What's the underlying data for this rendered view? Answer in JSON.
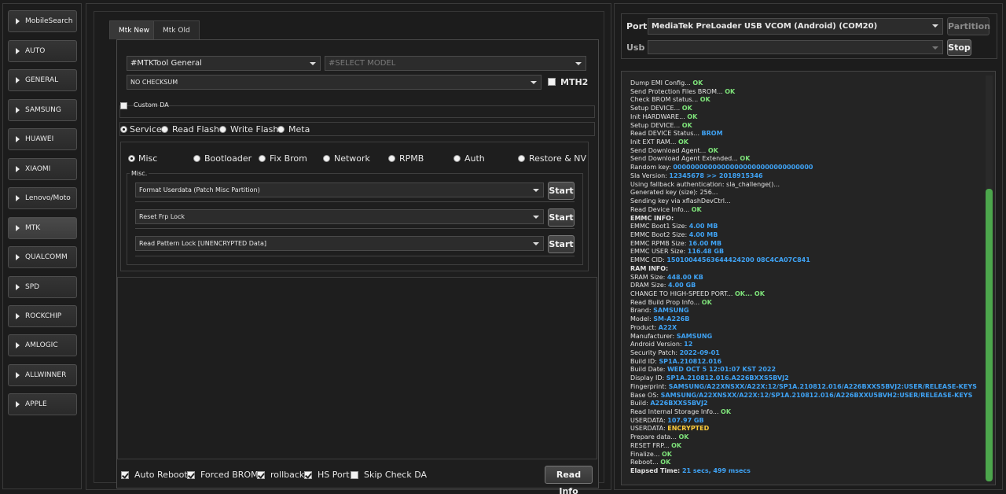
{
  "sidebar": {
    "items": [
      {
        "label": "MobileSearch"
      },
      {
        "label": "AUTO"
      },
      {
        "label": "GENERAL"
      },
      {
        "label": "SAMSUNG"
      },
      {
        "label": "HUAWEI"
      },
      {
        "label": "XIAOMI"
      },
      {
        "label": "Lenovo/Moto"
      },
      {
        "label": "MTK",
        "active": true
      },
      {
        "label": "QUALCOMM"
      },
      {
        "label": "SPD"
      },
      {
        "label": "ROCKCHIP"
      },
      {
        "label": "AMLOGIC"
      },
      {
        "label": "ALLWINNER"
      },
      {
        "label": "APPLE"
      }
    ]
  },
  "tabs": [
    {
      "label": "Mtk New",
      "active": true
    },
    {
      "label": "Mtk Old",
      "active": false
    }
  ],
  "config": {
    "tool_select": "#MTKTool General",
    "model_select": "#SELECT MODEL",
    "checksum_select": "NO CHECKSUM",
    "mth2_label": "MTH2",
    "custom_da_label": "Custom DA"
  },
  "modes": [
    "Service",
    "Read Flash",
    "Write Flash",
    "Meta"
  ],
  "sub_modes": [
    "Misc",
    "Bootloader",
    "Fix Brom",
    "Network",
    "RPMB",
    "Auth",
    "Restore & NV"
  ],
  "misc": {
    "group_label": "Misc.",
    "ops": [
      {
        "label": "Format Userdata (Patch Misc Partition)",
        "button": "Start"
      },
      {
        "label": "Reset Frp Lock",
        "button": "Start"
      },
      {
        "label": "Read Pattern Lock [UNENCRYPTED Data]",
        "button": "Start"
      }
    ]
  },
  "options": {
    "auto_reboot": "Auto Reboot",
    "forced_brom": "Forced BROM",
    "rollback": "rollback",
    "hs_port": "HS Port",
    "skip_check_da": "Skip Check DA",
    "read_info_button": "Read Info"
  },
  "port": {
    "port_label": "Port",
    "port_value": "MediaTek PreLoader USB VCOM (Android) (COM20)",
    "partition_button": "Partition",
    "usb_label": "Usb",
    "usb_value": "",
    "stop_button": "Stop"
  },
  "log": [
    {
      "text": "Dump EMI Config... ",
      "value": "OK",
      "type": "ok"
    },
    {
      "text": "Send Protection Files BROM... ",
      "value": "OK",
      "type": "ok"
    },
    {
      "text": "Check BROM status... ",
      "value": "OK",
      "type": "ok"
    },
    {
      "text": "Setup DEVICE... ",
      "value": "OK",
      "type": "ok"
    },
    {
      "text": "Init HARDWARE... ",
      "value": "OK",
      "type": "ok"
    },
    {
      "text": "Setup DEVICE... ",
      "value": "OK",
      "type": "ok"
    },
    {
      "text": "Read DEVICE Status... ",
      "value": "BROM",
      "type": "info"
    },
    {
      "text": "Init EXT RAM... ",
      "value": "OK",
      "type": "ok"
    },
    {
      "text": "Send Download Agent... ",
      "value": "OK",
      "type": "ok"
    },
    {
      "text": "Send Download Agent Extended... ",
      "value": "OK",
      "type": "ok"
    },
    {
      "text": "Random key:  ",
      "value": "00000000000000000000000000000000",
      "type": "info"
    },
    {
      "text": "Sla Version:  ",
      "value": "12345678  >> 2018915346",
      "type": "info"
    },
    {
      "text": "Using fallback authentication: sla_challenge()...",
      "value": "",
      "type": ""
    },
    {
      "text": "Generated key (size): 256...",
      "value": "",
      "type": ""
    },
    {
      "text": "Sending key via xflashDevCtrl...",
      "value": "",
      "type": ""
    },
    {
      "text": "Read Device Info... ",
      "value": "OK",
      "type": "ok"
    },
    {
      "text": "EMMC INFO:",
      "value": "",
      "type": "",
      "bold": true
    },
    {
      "text": "EMMC Boot1 Size: ",
      "value": "4.00 MB",
      "type": "info"
    },
    {
      "text": "EMMC Boot2 Size: ",
      "value": "4.00 MB",
      "type": "info"
    },
    {
      "text": "EMMC RPMB Size: ",
      "value": "16.00 MB",
      "type": "info"
    },
    {
      "text": "EMMC USER Size: ",
      "value": "116.48 GB",
      "type": "info"
    },
    {
      "text": "EMMC CID: ",
      "value": "15010044563644424200 08C4CA07C841",
      "type": "info"
    },
    {
      "text": "RAM INFO:",
      "value": "",
      "type": "",
      "bold": true
    },
    {
      "text": "SRAM Size: ",
      "value": "448.00 KB",
      "type": "info"
    },
    {
      "text": "DRAM Size: ",
      "value": "4.00 GB",
      "type": "info"
    },
    {
      "text": "CHANGE TO HIGH-SPEED PORT... ",
      "value": "OK... OK",
      "type": "ok"
    },
    {
      "text": "Read Build Prop Info... ",
      "value": "OK",
      "type": "ok"
    },
    {
      "text": " Brand: ",
      "value": "SAMSUNG",
      "type": "info"
    },
    {
      "text": " Model: ",
      "value": "SM-A226B",
      "type": "info"
    },
    {
      "text": " Product: ",
      "value": "A22X",
      "type": "info"
    },
    {
      "text": " Manufacturer: ",
      "value": "SAMSUNG",
      "type": "info"
    },
    {
      "text": " Android Version: ",
      "value": "12",
      "type": "info"
    },
    {
      "text": " Security Patch: ",
      "value": "2022-09-01",
      "type": "info"
    },
    {
      "text": " Build ID: ",
      "value": "SP1A.210812.016",
      "type": "info"
    },
    {
      "text": " Build Date: ",
      "value": "WED OCT  5 12:01:07 KST 2022",
      "type": "info"
    },
    {
      "text": " Display ID: ",
      "value": "SP1A.210812.016.A226BXXS5BVJ2",
      "type": "info"
    },
    {
      "text": " Fingerprint: ",
      "value": "SAMSUNG/A22XNSXX/A22X:12/SP1A.210812.016/A226BXXS5BVJ2:USER/RELEASE-KEYS",
      "type": "info"
    },
    {
      "text": " Base OS: ",
      "value": "SAMSUNG/A22XNSXX/A22X:12/SP1A.210812.016/A226BXXU5BVH2:USER/RELEASE-KEYS",
      "type": "info"
    },
    {
      "text": " Build: ",
      "value": "A226BXXS5BVJ2",
      "type": "info"
    },
    {
      "text": "Read Internal Storage Info... ",
      "value": "OK",
      "type": "ok"
    },
    {
      "text": "USERDATA: ",
      "value": "107.97 GB",
      "type": "info"
    },
    {
      "text": "USERDATA: ",
      "value": "ENCRYPTED",
      "type": "warn"
    },
    {
      "text": "Prepare data... ",
      "value": "OK",
      "type": "ok"
    },
    {
      "text": "RESET FRP... ",
      "value": "OK",
      "type": "ok"
    },
    {
      "text": "Finalize... ",
      "value": "OK",
      "type": "ok"
    },
    {
      "text": "Reboot... ",
      "value": "OK",
      "type": "ok"
    },
    {
      "text": "Elapsed Time: ",
      "value": "21 secs, 499 msecs",
      "type": "info",
      "bold": true
    }
  ],
  "colors": {
    "ok": "#7ee37a",
    "info": "#3fa3f5",
    "warn": "#ffcc3a",
    "scrollbar_thumb": "#4ca64c"
  }
}
